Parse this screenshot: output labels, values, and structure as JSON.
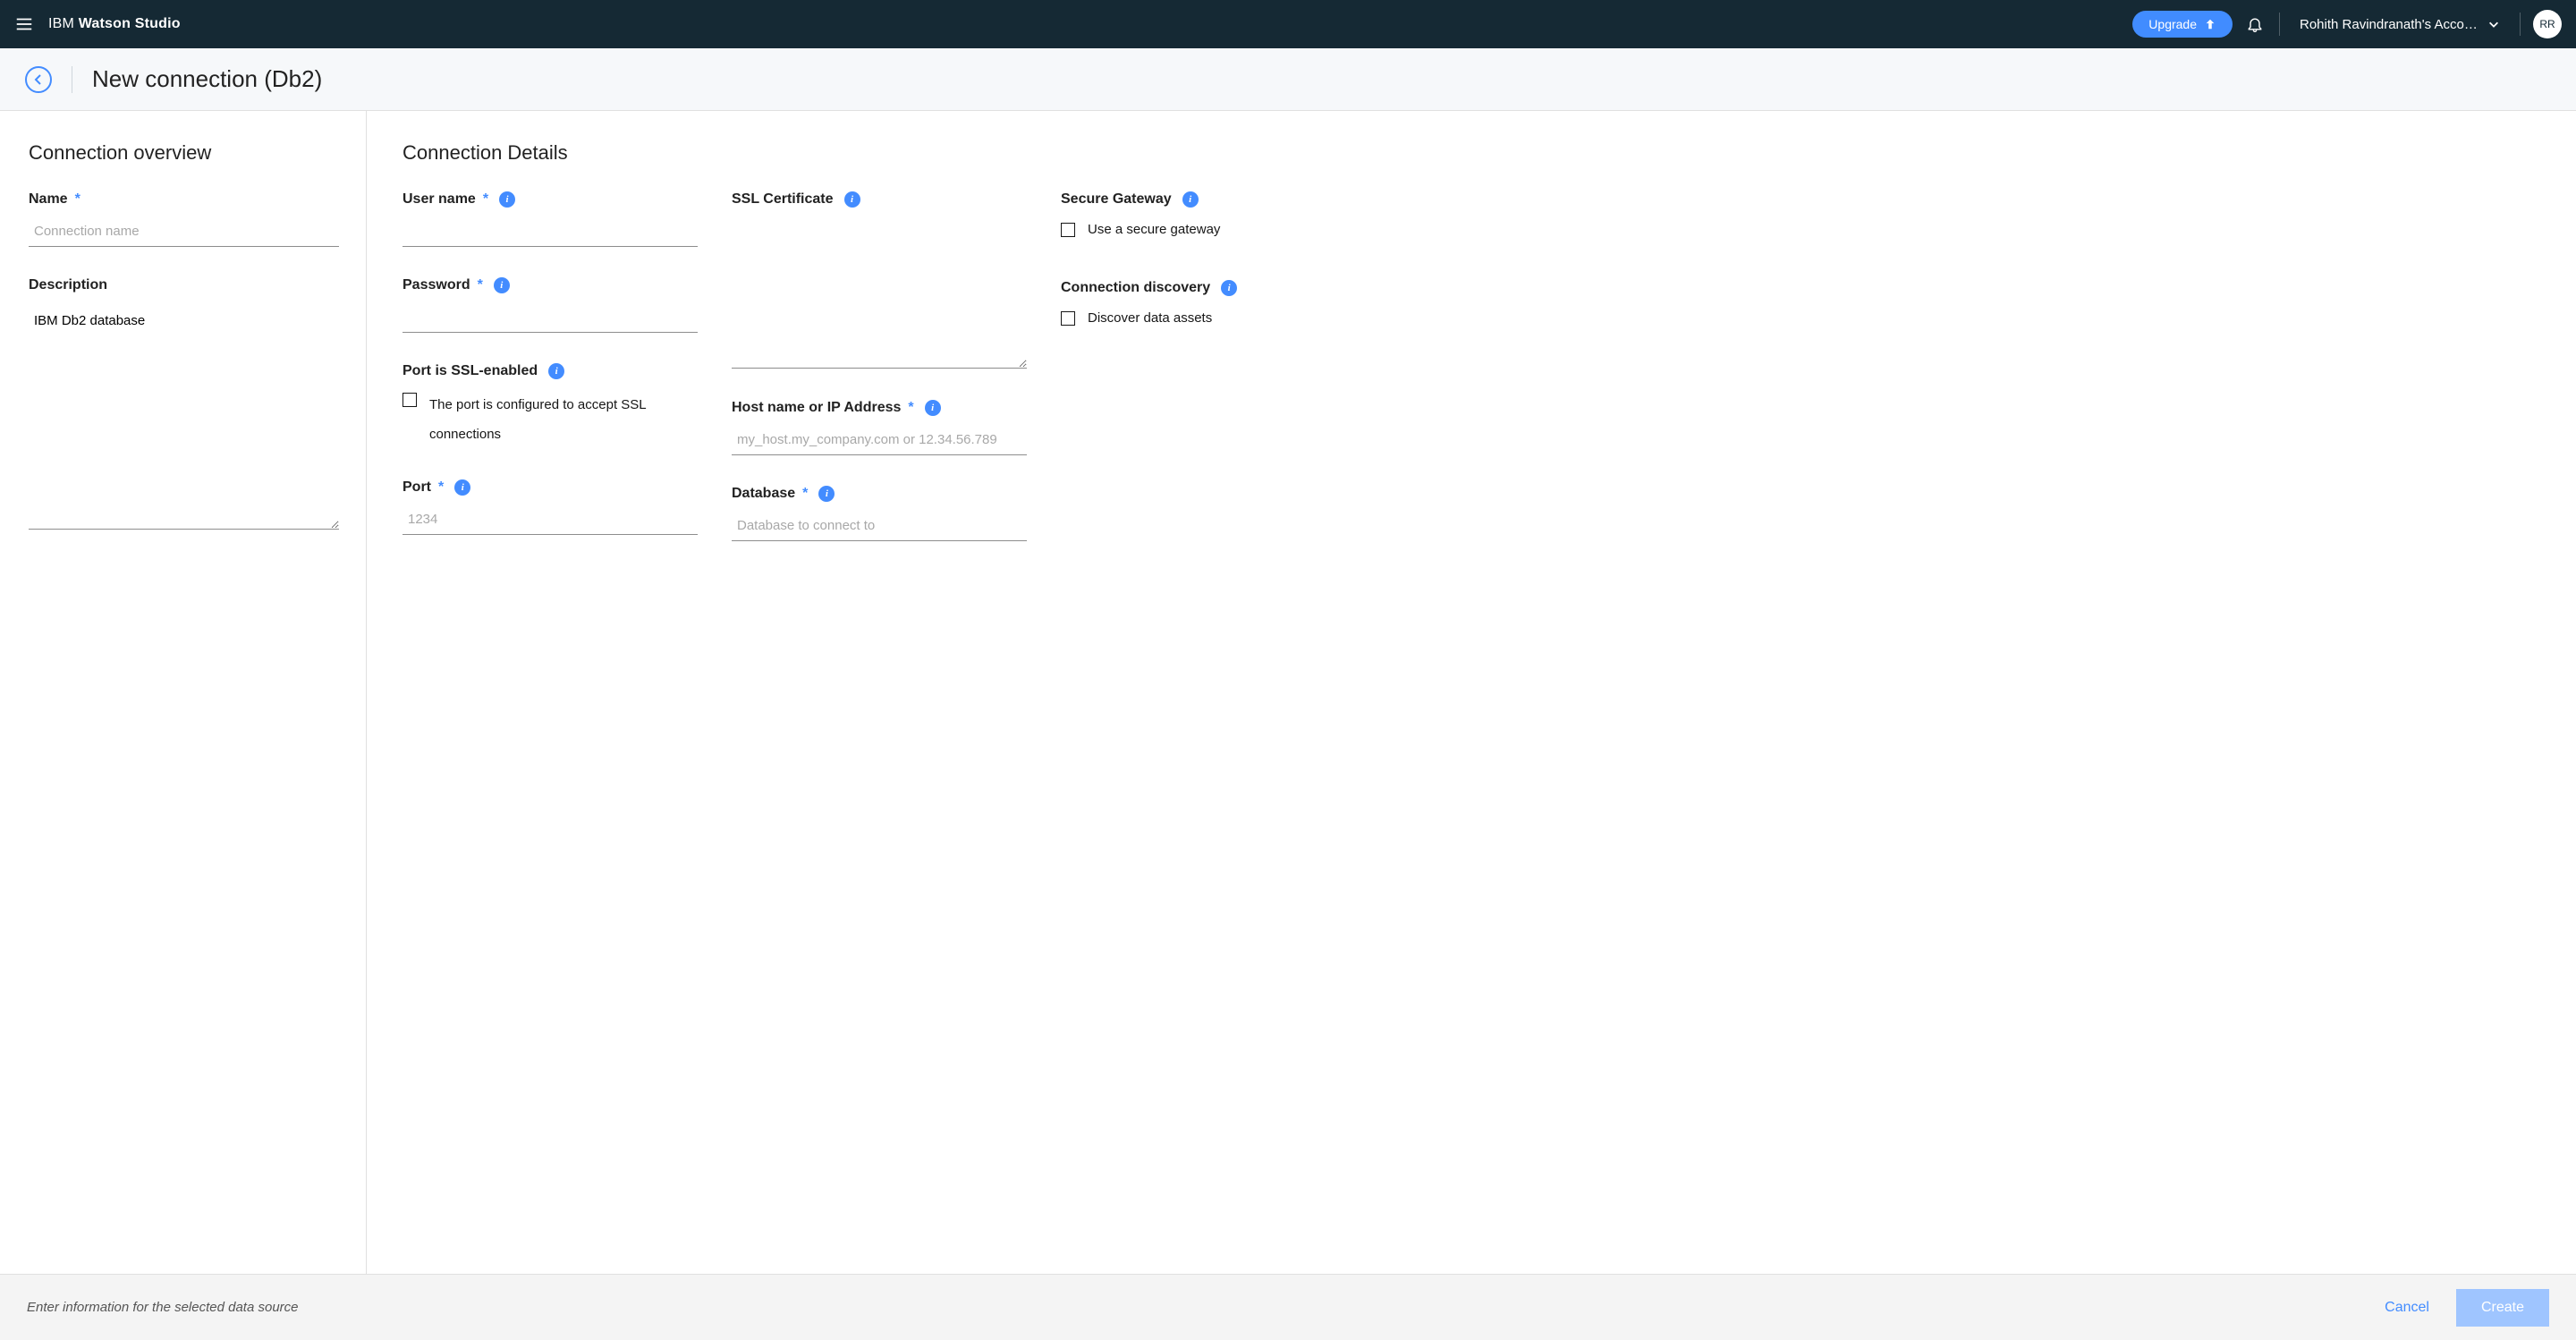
{
  "header": {
    "brand_prefix": "IBM ",
    "brand_bold": "Watson Studio",
    "upgrade_label": "Upgrade",
    "account_name": "Rohith Ravindranath's Accou…",
    "avatar_initials": "RR"
  },
  "subheader": {
    "title": "New connection (Db2)"
  },
  "overview": {
    "section_title": "Connection overview",
    "name_label": "Name",
    "name_placeholder": "Connection name",
    "description_label": "Description",
    "description_value": "IBM Db2 database"
  },
  "details": {
    "section_title": "Connection Details",
    "username_label": "User name",
    "password_label": "Password",
    "ssl_enabled_label": "Port is SSL-enabled",
    "ssl_enabled_checkbox_text": "The port is configured to accept SSL connections",
    "port_label": "Port",
    "port_placeholder": "1234",
    "ssl_cert_label": "SSL Certificate",
    "host_label": "Host name or IP Address",
    "host_placeholder": "my_host.my_company.com or 12.34.56.789",
    "database_label": "Database",
    "database_placeholder": "Database to connect to",
    "secure_gateway_label": "Secure Gateway",
    "secure_gateway_checkbox": "Use a secure gateway",
    "discovery_label": "Connection discovery",
    "discovery_checkbox": "Discover data assets"
  },
  "footer": {
    "hint": "Enter information for the selected data source",
    "cancel_label": "Cancel",
    "create_label": "Create"
  }
}
